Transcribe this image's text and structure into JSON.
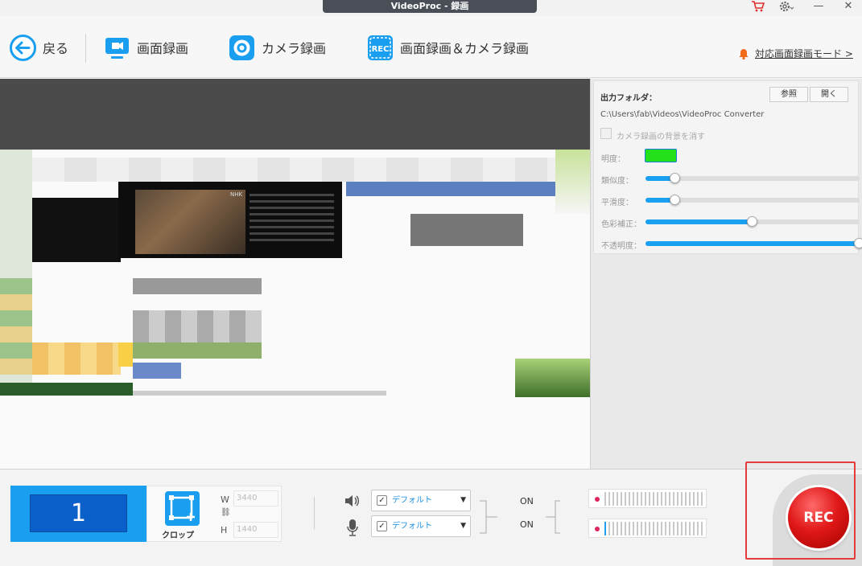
{
  "window": {
    "title": "VideoProc - 録画",
    "cart_icon": "cart-icon",
    "settings_icon": "gear-icon",
    "minimize": "—",
    "close": "✕"
  },
  "toolbar": {
    "back_label": "戻る",
    "screen_record_label": "画面録画",
    "camera_record_label": "カメラ録画",
    "screen_camera_record_label": "画面録画＆カメラ録画",
    "rec_icon_text": "REC",
    "mode_link": "対応画面録画モード >"
  },
  "panel": {
    "output_folder_label": "出力フォルダ：",
    "browse_button": "参照",
    "open_button": "開く",
    "output_path": "C:\\Users\\fab\\Videos\\VideoProc Converter",
    "remove_bg_label": "カメラ録画の背景を消す",
    "brightness_label": "明度：",
    "brightness_color": "#22e01a",
    "sliders": [
      {
        "label": "類似度：",
        "value": 0.14
      },
      {
        "label": "平滑度：",
        "value": 0.14
      },
      {
        "label": "色彩補正：",
        "value": 0.5
      },
      {
        "label": "不透明度：",
        "value": 1.0
      }
    ]
  },
  "bottom": {
    "screen_number": "1",
    "crop_label": "クロップ",
    "width_label": "W",
    "width_value": "3440",
    "height_label": "H",
    "height_value": "1440",
    "speaker_device": "デフォルト",
    "mic_device": "デフォルト",
    "speaker_state": "ON",
    "mic_state": "ON",
    "speaker_level": 0.0,
    "mic_level": 0.03,
    "rec_button": "REC"
  },
  "preview": {
    "video_caption": "NHK"
  }
}
